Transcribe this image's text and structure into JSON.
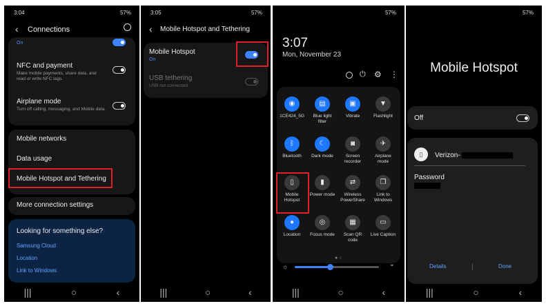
{
  "panel1": {
    "time": "3:04",
    "status_right": "57%",
    "header_title": "Connections",
    "top_sub": "On",
    "nfc": {
      "title": "NFC and payment",
      "sub": "Make mobile payments, share data, and read or write NFC tags."
    },
    "airplane": {
      "title": "Airplane mode",
      "sub": "Turn off calling, messaging, and Mobile data."
    },
    "items": [
      "Mobile networks",
      "Data usage",
      "Mobile Hotspot and Tethering"
    ],
    "more": "More connection settings",
    "help": {
      "title": "Looking for something else?",
      "links": [
        "Samsung Cloud",
        "Location",
        "Link to Windows"
      ]
    }
  },
  "panel2": {
    "time": "3:05",
    "status_right": "57%",
    "header_title": "Mobile Hotspot and Tethering",
    "hotspot": {
      "title": "Mobile Hotspot",
      "sub": "On"
    },
    "usb": {
      "title": "USB tethering",
      "sub": "USB not connected"
    }
  },
  "panel3": {
    "status_right": "57%",
    "clock": "3:07",
    "date": "Mon, November 23",
    "tiles": [
      {
        "label": "1CE424_5G",
        "icon": "wifi-icon",
        "glyph": "◉",
        "active": true
      },
      {
        "label": "Blue light filter",
        "icon": "blue-light-icon",
        "glyph": "▤",
        "active": true
      },
      {
        "label": "Vibrate",
        "icon": "vibrate-icon",
        "glyph": "▣",
        "active": true
      },
      {
        "label": "Flashlight",
        "icon": "flashlight-icon",
        "glyph": "▼",
        "active": false
      },
      {
        "label": "Bluetooth",
        "icon": "bluetooth-icon",
        "glyph": "ᛒ",
        "active": true
      },
      {
        "label": "Dark mode",
        "icon": "dark-mode-icon",
        "glyph": "☾",
        "active": true
      },
      {
        "label": "Screen recorder",
        "icon": "screen-recorder-icon",
        "glyph": "◙",
        "active": false
      },
      {
        "label": "Airplane mode",
        "icon": "airplane-icon",
        "glyph": "✈",
        "active": false
      },
      {
        "label": "Mobile Hotspot",
        "icon": "mobile-hotspot-icon",
        "glyph": "▯",
        "active": false
      },
      {
        "label": "Power mode",
        "icon": "power-mode-icon",
        "glyph": "▮",
        "active": false
      },
      {
        "label": "Wireless PowerShare",
        "icon": "powershare-icon",
        "glyph": "⇄",
        "active": false
      },
      {
        "label": "Link to Windows",
        "icon": "link-windows-icon",
        "glyph": "❐",
        "active": false
      },
      {
        "label": "Location",
        "icon": "location-icon",
        "glyph": "●",
        "active": true
      },
      {
        "label": "Focus mode",
        "icon": "focus-mode-icon",
        "glyph": "◎",
        "active": false
      },
      {
        "label": "Scan QR code",
        "icon": "qr-icon",
        "glyph": "▦",
        "active": false
      },
      {
        "label": "Live Caption",
        "icon": "live-caption-icon",
        "glyph": "▭",
        "active": false
      }
    ],
    "brightness_level": 0.42
  },
  "panel4": {
    "status_right": "57%",
    "title": "Mobile Hotspot",
    "off_label": "Off",
    "network_name": "Verizon-",
    "password_label": "Password",
    "details": "Details",
    "done": "Done"
  }
}
